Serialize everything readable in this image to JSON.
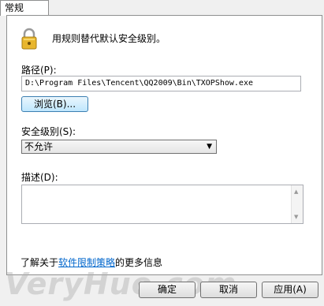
{
  "tabs": [
    {
      "label": "常规",
      "active": true
    }
  ],
  "description": "用规则替代默认安全级别。",
  "path": {
    "label": "路径(P):",
    "value": "D:\\Program Files\\Tencent\\QQ2009\\Bin\\TXOPShow.exe"
  },
  "browse_button": "浏览(B)...",
  "security_level": {
    "label": "安全级别(S):",
    "selected": "不允许"
  },
  "description_field": {
    "label": "描述(D):",
    "value": ""
  },
  "info_line": {
    "prefix": "了解关于",
    "link": "软件限制策略",
    "suffix": "的更多信息"
  },
  "buttons": {
    "ok": "确定",
    "cancel": "取消",
    "apply": "应用(A)"
  },
  "watermark": "VeryHuo.com",
  "icons": {
    "lock": "lock-icon",
    "dropdown": "chevron-down-icon"
  }
}
